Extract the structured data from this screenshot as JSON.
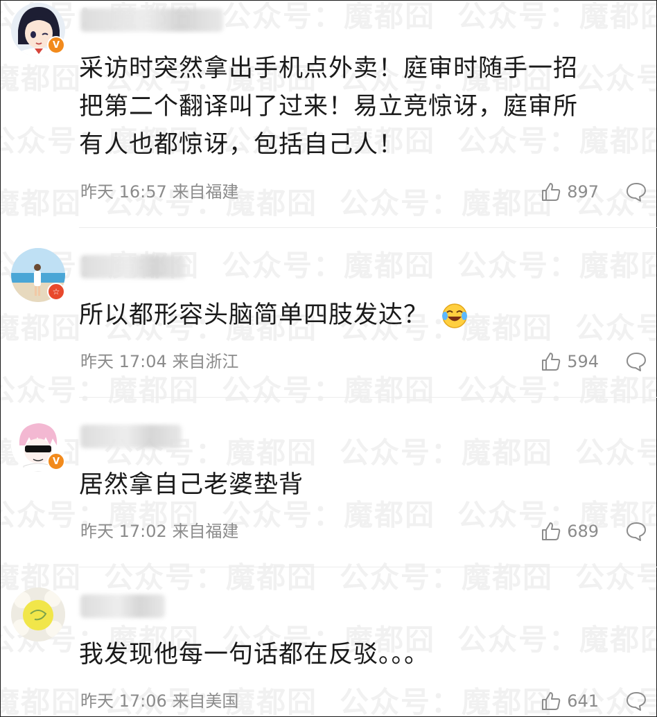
{
  "watermark": {
    "text": "公众号：魔都囧"
  },
  "colors": {
    "badge_orange": "#f28a1c",
    "badge_red": "#e8492c",
    "meta_gray": "#8b8b8b",
    "text": "#1a1a1a"
  },
  "comments": [
    {
      "username": "",
      "badge": {
        "type": "verified",
        "symbol": "V",
        "color": "#f28a1c"
      },
      "text_lines": [
        "采访时突然拿出手机点外卖！庭审时随手一招",
        "把第二个翻译叫了过来！易立竞惊讶，庭审所",
        "有人也都惊讶，包括自己人！"
      ],
      "time": "昨天 16:57",
      "location": "来自福建",
      "likes": "897",
      "emoji": ""
    },
    {
      "username": "",
      "badge": {
        "type": "star",
        "symbol": "☆",
        "color": "#e8492c"
      },
      "text_lines": [
        "所以都形容头脑简单四肢发达？"
      ],
      "time": "昨天 17:04",
      "location": "来自浙江",
      "likes": "594",
      "emoji": "laughing-tears-emoji"
    },
    {
      "username": "",
      "badge": {
        "type": "verified",
        "symbol": "V",
        "color": "#f28a1c"
      },
      "text_lines": [
        "居然拿自己老婆垫背"
      ],
      "time": "昨天 17:02",
      "location": "来自福建",
      "likes": "689",
      "emoji": ""
    },
    {
      "username": "",
      "badge": null,
      "text_lines": [
        "我发现他每一句话都在反驳。。。"
      ],
      "time": "昨天 17:06",
      "location": "来自美国",
      "likes": "641",
      "emoji": ""
    }
  ]
}
